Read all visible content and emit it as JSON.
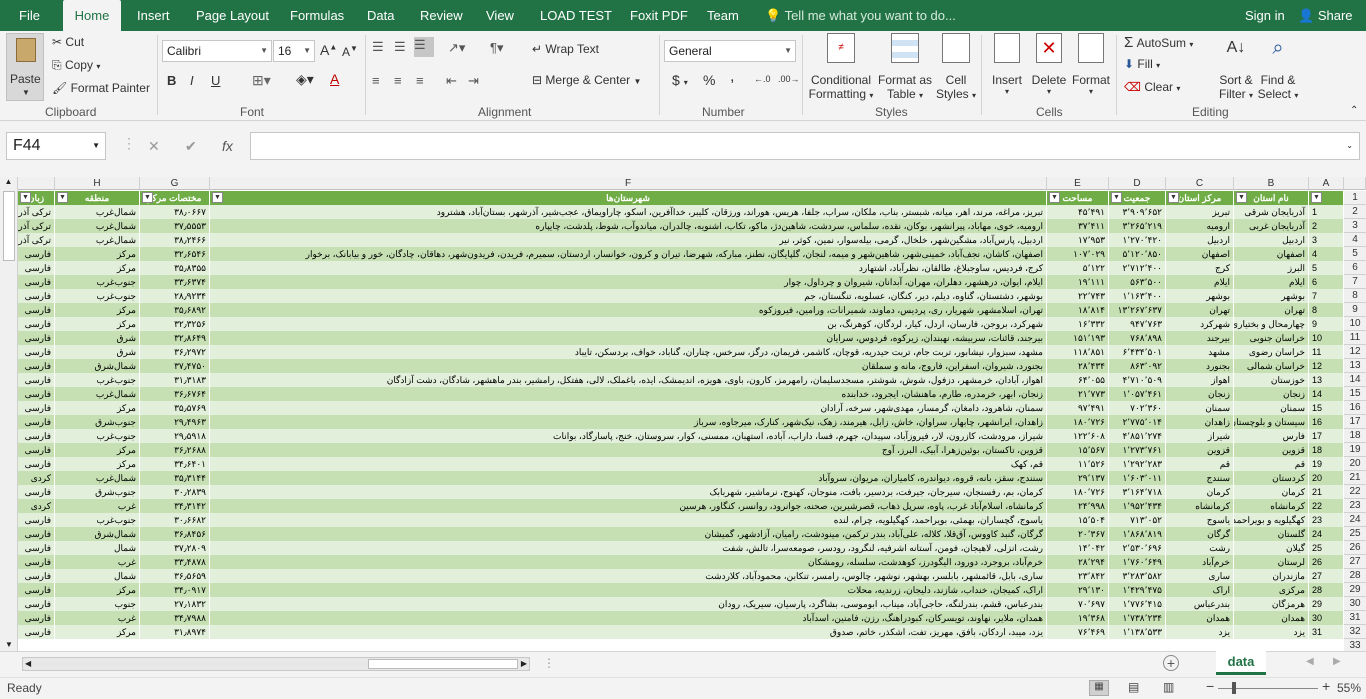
{
  "menu": {
    "tabs": [
      "File",
      "Home",
      "Insert",
      "Page Layout",
      "Formulas",
      "Data",
      "Review",
      "View",
      "LOAD TEST",
      "Foxit PDF",
      "Team"
    ],
    "active": "Home",
    "tell_me": "Tell me what you want to do...",
    "sign_in": "Sign in",
    "share": "Share"
  },
  "ribbon": {
    "clipboard": {
      "paste": "Paste",
      "cut": "Cut",
      "copy": "Copy",
      "format_painter": "Format Painter",
      "label": "Clipboard"
    },
    "font": {
      "name": "Calibri",
      "size": "16",
      "label": "Font",
      "bold": "B",
      "italic": "I",
      "underline": "U"
    },
    "alignment": {
      "wrap": "Wrap Text",
      "merge": "Merge & Center",
      "label": "Alignment"
    },
    "number": {
      "format": "General",
      "currency": "$",
      "percent": "%",
      "comma": ",",
      "label": "Number"
    },
    "styles": {
      "conditional": "Conditional",
      "formatting": "Formatting",
      "format_as": "Format as",
      "table": "Table",
      "cell": "Cell",
      "cell_styles": "Styles",
      "label": "Styles"
    },
    "cells": {
      "insert": "Insert",
      "delete": "Delete",
      "format": "Format",
      "label": "Cells"
    },
    "editing": {
      "autosum": "AutoSum",
      "fill": "Fill",
      "clear": "Clear",
      "sort": "Sort &",
      "filter": "Filter",
      "find": "Find &",
      "select": "Select",
      "label": "Editing"
    }
  },
  "formula_bar": {
    "name_box": "F44",
    "cancel": "✕",
    "enter": "✔",
    "fx": "fx",
    "value": ""
  },
  "columns": [
    "A",
    "B",
    "C",
    "D",
    "E",
    "F",
    "G",
    "H"
  ],
  "headers": {
    "b": "نام استان",
    "c": "مرکز استان",
    "d": "جمعیت",
    "e": "مساحت",
    "f": "شهرستان‌ها",
    "g": "مختصات مرکز",
    "h": "منطقه",
    "i": "زبان"
  },
  "rows": [
    {
      "n": "1",
      "b": "آذربایجان شرقی",
      "c": "تبریز",
      "d": "۳٬۹۰۹٬۶۵۲",
      "e": "۴۵٬۴۹۱",
      "f": "تبریز، مراغه، مرند، اهر، میانه، شبستر، بناب، ملکان، سراب، جلفا، هریس، هوراند، ورزقان، کلیبر، خداآفرین، اسکو، چاراویماق، عجب‌شیر، آذرشهر، بستان‌آباد، هشترود",
      "g": "۳۸٫۰۶۶۷",
      "h": "شمال‌غرب",
      "i": "ترکی آذری"
    },
    {
      "n": "2",
      "b": "آذربایجان غربی",
      "c": "ارومیه",
      "d": "۳٬۲۶۵٬۲۱۹",
      "e": "۳۷٬۴۱۱",
      "f": "ارومیه، خوی، مهاباد، پیرانشهر، بوکان، نقده، سلماس، سردشت، شاهین‌دژ، ماکو، تکاب، اشنویه، چالدران، میاندوآب، شوط، پلدشت، چایپاره",
      "g": "۳۷٫۵۵۵۳",
      "h": "شمال‌غرب",
      "i": "ترکی آذری"
    },
    {
      "n": "3",
      "b": "اردبیل",
      "c": "اردبیل",
      "d": "۱٬۲۷۰٬۴۲۰",
      "e": "۱۷٬۹۵۳",
      "f": "اردبیل، پارس‌آباد، مشگین‌شهر، خلخال، گرمی، بیله‌سوار، نمین، کوثر، نیر",
      "g": "۳۸٫۲۴۶۶",
      "h": "شمال‌غرب",
      "i": "ترکی آذری"
    },
    {
      "n": "4",
      "b": "اصفهان",
      "c": "اصفهان",
      "d": "۵٬۱۲۰٬۸۵۰",
      "e": "۱۰۷٬۰۲۹",
      "f": "اصفهان، کاشان، نجف‌آباد، خمینی‌شهر، شاهین‌شهر و میمه، لنجان، گلپایگان، نطنز، مبارکه، شهرضا، تیران و کرون، خوانسار، اردستان، سمیرم، فریدن، فریدون‌شهر، دهاقان، چادگان، خور و بیابانک، برخوار",
      "g": "۳۲٫۶۵۴۶",
      "h": "مرکز",
      "i": "فارسی"
    },
    {
      "n": "5",
      "b": "البرز",
      "c": "کرج",
      "d": "۲٬۷۱۲٬۴۰۰",
      "e": "۵٬۱۲۲",
      "f": "کرج، فردیس، ساوجبلاغ، طالقان، نظرآباد، اشتهارد",
      "g": "۳۵٫۸۳۵۵",
      "h": "مرکز",
      "i": "فارسی"
    },
    {
      "n": "6",
      "b": "ایلام",
      "c": "ایلام",
      "d": "۵۶۳٬۵۰۰",
      "e": "۱۹٬۱۱۱",
      "f": "ایلام، ایوان، درهشهر، دهلران، مهران، آبدانان، شیروان و چرداول، چوار",
      "g": "۳۳٫۶۳۷۴",
      "h": "جنوب‌غرب",
      "i": "فارسی"
    },
    {
      "n": "7",
      "b": "بوشهر",
      "c": "بوشهر",
      "d": "۱٬۱۶۳٬۴۰۰",
      "e": "۲۲٬۷۴۳",
      "f": "بوشهر، دشتستان، گناوه، دیلم، دیر، کنگان، عسلویه، تنگستان، جم",
      "g": "۲۸٫۹۲۳۴",
      "h": "جنوب‌غرب",
      "i": "فارسی"
    },
    {
      "n": "8",
      "b": "تهران",
      "c": "تهران",
      "d": "۱۳٬۲۶۷٬۶۳۷",
      "e": "۱۸٬۸۱۴",
      "f": "تهران، اسلامشهر، شهریار، ری، پردیس، دماوند، شمیرانات، ورامین، فیروزکوه",
      "g": "۳۵٫۶۸۹۲",
      "h": "مرکز",
      "i": "فارسی"
    },
    {
      "n": "9",
      "b": "چهارمحال و بختیاری",
      "c": "شهرکرد",
      "d": "۹۴۷٬۷۶۳",
      "e": "۱۶٬۳۳۲",
      "f": "شهرکرد، بروجن، فارسان، اردل، کیار، لردگان، کوهرنگ، بن",
      "g": "۳۲٫۳۲۵۶",
      "h": "مرکز",
      "i": "فارسی"
    },
    {
      "n": "10",
      "b": "خراسان جنوبی",
      "c": "بیرجند",
      "d": "۷۶۸٬۸۹۸",
      "e": "۱۵۱٬۱۹۳",
      "f": "بیرجند، قائنات، سربیشه، نهبندان، زیرکوه، فردوس، سرایان",
      "g": "۳۲٫۸۶۴۹",
      "h": "شرق",
      "i": "فارسی"
    },
    {
      "n": "11",
      "b": "خراسان رضوی",
      "c": "مشهد",
      "d": "۶٬۴۳۴٬۵۰۱",
      "e": "۱۱۸٬۸۵۱",
      "f": "مشهد، سبزوار، نیشابور، تربت جام، تربت حیدریه، قوچان، کاشمر، فریمان، درگز، سرخس، چناران، گناباد، خواف، بردسکن، تایباد",
      "g": "۳۶٫۲۹۷۲",
      "h": "شرق",
      "i": "فارسی"
    },
    {
      "n": "12",
      "b": "خراسان شمالی",
      "c": "بجنورد",
      "d": "۸۶۳٬۰۹۲",
      "e": "۲۸٬۴۳۴",
      "f": "بجنورد، شیروان، اسفراین، فاروج، مانه و سملقان",
      "g": "۳۷٫۴۷۵۰",
      "h": "شمال‌شرق",
      "i": "فارسی"
    },
    {
      "n": "13",
      "b": "خوزستان",
      "c": "اهواز",
      "d": "۴٬۷۱۰٬۵۰۹",
      "e": "۶۴٬۰۵۵",
      "f": "اهواز، آبادان، خرمشهر، دزفول، شوش، شوشتر، مسجدسلیمان، رامهرمز، کارون، باوی، هویزه، اندیمشک، ایذه، باغملک، لالی، هفتکل، رامشیر، بندر ماهشهر، شادگان، دشت آزادگان",
      "g": "۳۱٫۳۱۸۳",
      "h": "جنوب‌غرب",
      "i": "فارسی"
    },
    {
      "n": "14",
      "b": "زنجان",
      "c": "زنجان",
      "d": "۱٬۰۵۷٬۴۶۱",
      "e": "۲۱٬۷۷۳",
      "f": "زنجان، ابهر، خرمدره، طارم، ماهنشان، ایجرود، خدابنده",
      "g": "۳۶٫۶۷۶۴",
      "h": "شمال‌غرب",
      "i": "فارسی"
    },
    {
      "n": "15",
      "b": "سمنان",
      "c": "سمنان",
      "d": "۷۰۲٬۳۶۰",
      "e": "۹۷٬۴۹۱",
      "f": "سمنان، شاهرود، دامغان، گرمسار، مهدی‌شهر، سرخه، آرادان",
      "g": "۳۵٫۵۷۶۹",
      "h": "مرکز",
      "i": "فارسی"
    },
    {
      "n": "16",
      "b": "سیستان و بلوچستان",
      "c": "زاهدان",
      "d": "۲٬۷۷۵٬۰۱۴",
      "e": "۱۸۰٬۷۲۶",
      "f": "زاهدان، ایرانشهر، چابهار، سراوان، خاش، زابل، هیرمند، زهک، نیک‌شهر، کنارک، میرجاوه، سرباز",
      "g": "۲۹٫۴۹۶۳",
      "h": "جنوب‌شرق",
      "i": "فارسی"
    },
    {
      "n": "17",
      "b": "فارس",
      "c": "شیراز",
      "d": "۴٬۸۵۱٬۲۷۴",
      "e": "۱۲۲٬۶۰۸",
      "f": "شیراز، مرودشت، کازرون، لار، فیروزآباد، سپیدان، جهرم، فسا، داراب، آباده، استهبان، ممسنی، کوار، سروستان، خنج، پاسارگاد، بوانات",
      "g": "۲۹٫۵۹۱۸",
      "h": "جنوب‌غرب",
      "i": "فارسی"
    },
    {
      "n": "18",
      "b": "قزوین",
      "c": "قزوین",
      "d": "۱٬۲۷۳٬۷۶۱",
      "e": "۱۵٬۵۶۷",
      "f": "قزوین، تاکستان، بوئین‌زهرا، آبیک، البرز، آوج",
      "g": "۳۶٫۲۶۸۸",
      "h": "مرکز",
      "i": "فارسی"
    },
    {
      "n": "19",
      "b": "قم",
      "c": "قم",
      "d": "۱٬۲۹۲٬۲۸۳",
      "e": "۱۱٬۵۲۶",
      "f": "قم، کهک",
      "g": "۳۴٫۶۴۰۱",
      "h": "مرکز",
      "i": "فارسی"
    },
    {
      "n": "20",
      "b": "کردستان",
      "c": "سنندج",
      "d": "۱٬۶۰۳٬۰۱۱",
      "e": "۲۹٬۱۳۷",
      "f": "سنندج، سقز، بانه، قروه، دیواندره، کامیاران، مریوان، سروآباد",
      "g": "۳۵٫۳۱۴۴",
      "h": "شمال‌غرب",
      "i": "کردی"
    },
    {
      "n": "21",
      "b": "کرمان",
      "c": "کرمان",
      "d": "۳٬۱۶۴٬۷۱۸",
      "e": "۱۸۰٬۷۲۶",
      "f": "کرمان، بم، رفسنجان، سیرجان، جیرفت، بردسیر، بافت، منوجان، کهنوج، نرماشیر، شهربابک",
      "g": "۳۰٫۲۸۳۹",
      "h": "جنوب‌شرق",
      "i": "فارسی"
    },
    {
      "n": "22",
      "b": "کرمانشاه",
      "c": "کرمانشاه",
      "d": "۱٬۹۵۲٬۴۳۴",
      "e": "۲۴٬۹۹۸",
      "f": "کرمانشاه، اسلام‌آباد غرب، پاوه، سرپل ذهاب، قصرشیرین، صحنه، جوانرود، روانسر، کنگاور، هرسین",
      "g": "۳۴٫۳۱۴۲",
      "h": "غرب",
      "i": "کردی"
    },
    {
      "n": "23",
      "b": "کهگیلویه و بویراحمد",
      "c": "یاسوج",
      "d": "۷۱۳٬۰۵۲",
      "e": "۱۵٬۵۰۴",
      "f": "یاسوج، گچساران، بهمئی، بویراحمد، کهگیلویه، چرام، لنده",
      "g": "۳۰٫۶۶۸۲",
      "h": "جنوب‌غرب",
      "i": "فارسی"
    },
    {
      "n": "24",
      "b": "گلستان",
      "c": "گرگان",
      "d": "۱٬۸۶۸٬۸۱۹",
      "e": "۲۰٬۳۶۷",
      "f": "گرگان، گنبد کاووس، آق‌قلا، کلاله، علی‌آباد، بندر ترکمن، مینودشت، رامیان، آزادشهر، گمیشان",
      "g": "۳۶٫۸۴۵۶",
      "h": "شمال‌شرق",
      "i": "فارسی"
    },
    {
      "n": "25",
      "b": "گیلان",
      "c": "رشت",
      "d": "۲٬۵۳۰٬۶۹۶",
      "e": "۱۴٬۰۴۲",
      "f": "رشت، انزلی، لاهیجان، فومن، آستانه اشرفیه، لنگرود، رودسر، صومعه‌سرا، تالش، شفت",
      "g": "۳۷٫۲۸۰۹",
      "h": "شمال",
      "i": "فارسی"
    },
    {
      "n": "26",
      "b": "لرستان",
      "c": "خرم‌آباد",
      "d": "۱٬۷۶۰٬۶۴۹",
      "e": "۲۸٬۲۹۴",
      "f": "خرم‌آباد، بروجرد، دورود، الیگودرز، کوهدشت، سلسله، رومشکان",
      "g": "۳۳٫۴۸۷۸",
      "h": "غرب",
      "i": "فارسی"
    },
    {
      "n": "27",
      "b": "مازندران",
      "c": "ساری",
      "d": "۳٬۲۸۳٬۵۸۲",
      "e": "۲۳٬۸۴۲",
      "f": "ساری، بابل، قائمشهر، بابلسر، بهشهر، نوشهر، چالوس، رامسر، تنکابن، محمودآباد، کلاردشت",
      "g": "۳۶٫۵۶۵۹",
      "h": "شمال",
      "i": "فارسی"
    },
    {
      "n": "28",
      "b": "مرکزی",
      "c": "اراک",
      "d": "۱٬۴۲۹٬۴۷۵",
      "e": "۲۹٬۱۳۰",
      "f": "اراک، کمیجان، خنداب، شازند، دلیجان، زرندیه، محلات",
      "g": "۳۴٫۰۹۱۷",
      "h": "مرکز",
      "i": "فارسی"
    },
    {
      "n": "29",
      "b": "هرمزگان",
      "c": "بندرعباس",
      "d": "۱٬۷۷۶٬۴۱۵",
      "e": "۷۰٬۶۹۷",
      "f": "بندرعباس، قشم، بندرلنگه، حاجی‌آباد، میناب، ابوموسی، بشاگرد، پارسیان، سیریک، رودان",
      "g": "۲۷٫۱۸۳۲",
      "h": "جنوب",
      "i": "فارسی"
    },
    {
      "n": "30",
      "b": "همدان",
      "c": "همدان",
      "d": "۱٬۷۳۸٬۲۳۴",
      "e": "۱۹٬۳۶۸",
      "f": "همدان، ملایر، نهاوند، تویسرکان، کبودراهنگ، رزن، فامنین، اسدآباد",
      "g": "۳۴٫۷۹۸۸",
      "h": "غرب",
      "i": "فارسی"
    },
    {
      "n": "31",
      "b": "یزد",
      "c": "یزد",
      "d": "۱٬۱۳۸٬۵۳۳",
      "e": "۷۶٬۴۶۹",
      "f": "یزد، میبد، اردکان، بافق، مهریز، تفت، اشکذر، خاتم، صدوق",
      "g": "۳۱٫۸۹۷۴",
      "h": "مرکز",
      "i": "فارسی"
    }
  ],
  "sheet_tab": "data",
  "status": {
    "ready": "Ready",
    "zoom": "55%"
  }
}
